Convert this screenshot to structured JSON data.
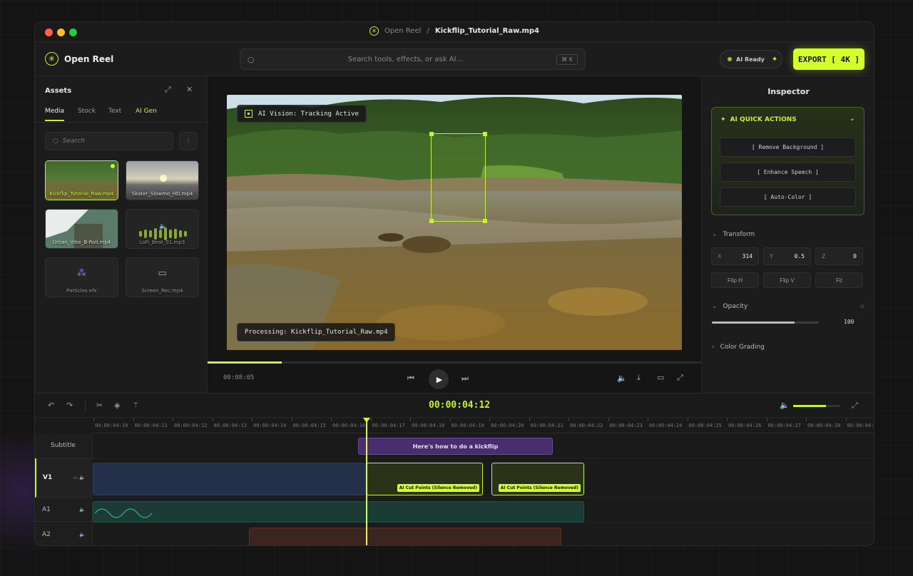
{
  "titlebar": {
    "app": "Open Reel",
    "separator": "/",
    "file": "Kickflip_Tutorial_Raw.mp4"
  },
  "header": {
    "brand": "Open Reel",
    "search_placeholder": "Search tools, effects, or ask AI...",
    "search_shortcut": "⌘ K",
    "ai_status": "AI Ready",
    "export_label": "EXPORT [ 4K ]"
  },
  "assets": {
    "title": "Assets",
    "tabs": [
      {
        "label": "Media"
      },
      {
        "label": "Stock"
      },
      {
        "label": "Text"
      },
      {
        "label": "AI Gen"
      }
    ],
    "search_placeholder": "Search",
    "items": [
      {
        "label": "Kickflip_Tutorial_Raw.mp4"
      },
      {
        "label": "Skater_Slowmo_HD.mp4"
      },
      {
        "label": "Urban_Vibe_B-Roll.mp4"
      },
      {
        "label": "LoFi_Beat_01.mp3"
      },
      {
        "label": "Particles.efx"
      },
      {
        "label": "Screen_Rec.mp4"
      }
    ]
  },
  "preview": {
    "ai_vision": "AI Vision: Tracking Active",
    "processing": "Processing: Kickflip_Tutorial_Raw.mp4",
    "timecode": "00:08:05",
    "progress": 0.15
  },
  "inspector": {
    "title": "Inspector",
    "quick_actions_title": "AI QUICK ACTIONS",
    "actions": [
      {
        "label": "[ Remove Background ]"
      },
      {
        "label": "[ Enhance Speech ]"
      },
      {
        "label": "[ Auto-Color ]"
      }
    ],
    "transform_title": "Transform",
    "fields": [
      {
        "key": "X",
        "value": "314"
      },
      {
        "key": "Y",
        "value": "0.5"
      },
      {
        "key": "Z",
        "value": "0"
      }
    ],
    "flip_buttons": [
      {
        "label": "Flip H"
      },
      {
        "label": "Flip V"
      },
      {
        "label": "Fit"
      }
    ],
    "opacity_title": "Opacity",
    "opacity_value": "100",
    "opacity_fraction": 0.77,
    "color_grading_title": "Color Grading"
  },
  "timeline": {
    "timecode": "00:00:04:12",
    "volume_fraction": 0.7,
    "ticks": [
      "00:00:04:10",
      "00:00:04:11",
      "00:00:04:12",
      "00:00:04:13",
      "00:00:04:14",
      "00:00:04:15",
      "00:00:04:16",
      "00:00:04:17",
      "00:00:04:18",
      "00:00:04:19",
      "00:00:04:20",
      "00:00:04:21",
      "00:00:04:22",
      "00:00:04:23",
      "00:00:04:24",
      "00:00:04:25",
      "00:00:04:26",
      "00:00:04:27",
      "00:00:04:28",
      "00:00:04:"
    ],
    "tracks": [
      {
        "name": "Subtitle"
      },
      {
        "name": "V1"
      },
      {
        "name": "A1"
      },
      {
        "name": "A2"
      }
    ],
    "subtitle_clip": "Here's how to do a kickflip",
    "cut_label": "AI Cut Points (Silence Removed)"
  },
  "colors": {
    "accent": "#d4ff2a",
    "subtitle_clip": "#4a2d6e",
    "video_clip": "#24304a",
    "audio_clip": "#1c3a36",
    "a2_clip": "#3c2420"
  }
}
